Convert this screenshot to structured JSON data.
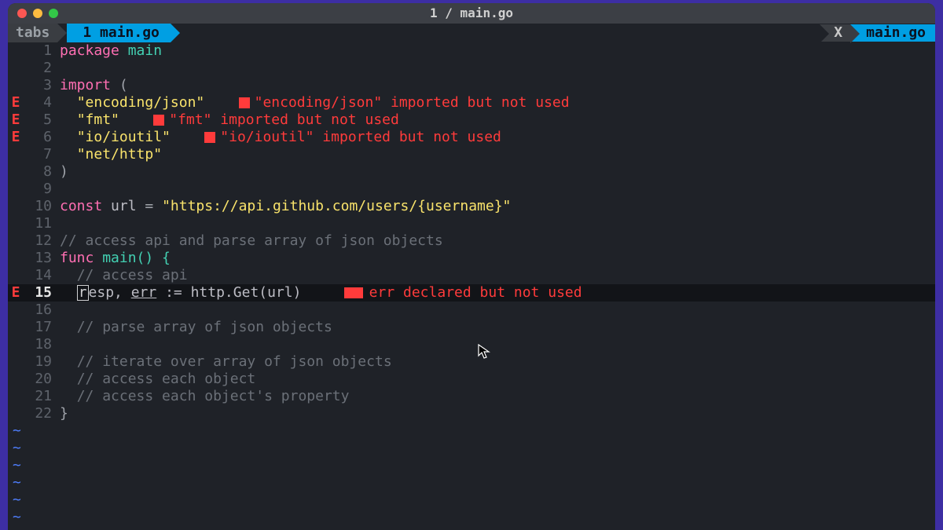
{
  "window": {
    "title": "1 / main.go"
  },
  "tabline": {
    "tabs_label": "tabs",
    "active_tab": "1 main.go",
    "close_label": "X",
    "file_label": " main.go "
  },
  "gutter": {
    "error_marker": "E"
  },
  "errors": {
    "json": "\"encoding/json\" imported but not used",
    "fmt": "\"fmt\" imported but not used",
    "ioutil": "\"io/ioutil\" imported but not used",
    "err": "err declared but not used"
  },
  "lines": {
    "n1": "1",
    "n2": "2",
    "n3": "3",
    "n4": "4",
    "n5": "5",
    "n6": "6",
    "n7": "7",
    "n8": "8",
    "n9": "9",
    "n10": "10",
    "n11": "11",
    "n12": "12",
    "n13": "13",
    "n14": "14",
    "n15": "15",
    "n16": "16",
    "n17": "17",
    "n18": "18",
    "n19": "19",
    "n20": "20",
    "n21": "21",
    "n22": "22"
  },
  "code": {
    "package_kw": "package",
    "package_name": " main",
    "import_kw": "import",
    "import_paren": " (",
    "imp_json": "\"encoding/json\"",
    "imp_fmt": "\"fmt\"",
    "imp_ioutil": "\"io/ioutil\"",
    "imp_http": "\"net/http\"",
    "close_paren": ")",
    "const_kw": "const",
    "const_rest_a": " url ",
    "const_eq": "=",
    "const_rest_b": " ",
    "url_str": "\"https://api.github.com/users/{username}\"",
    "c_access_api": "// access api and parse array of json objects",
    "func_kw": "func",
    "main_sig": " main() {",
    "c_access": "// access api",
    "resp_r": "r",
    "resp_rest": "esp, ",
    "err": "err",
    "assign": " := http.Get(url)",
    "c_parse": "// parse array of json objects",
    "c_iter": "// iterate over array of json objects",
    "c_each": "// access each object",
    "c_prop": "// access each object's property",
    "close_brace": "}"
  },
  "tilde": "~"
}
